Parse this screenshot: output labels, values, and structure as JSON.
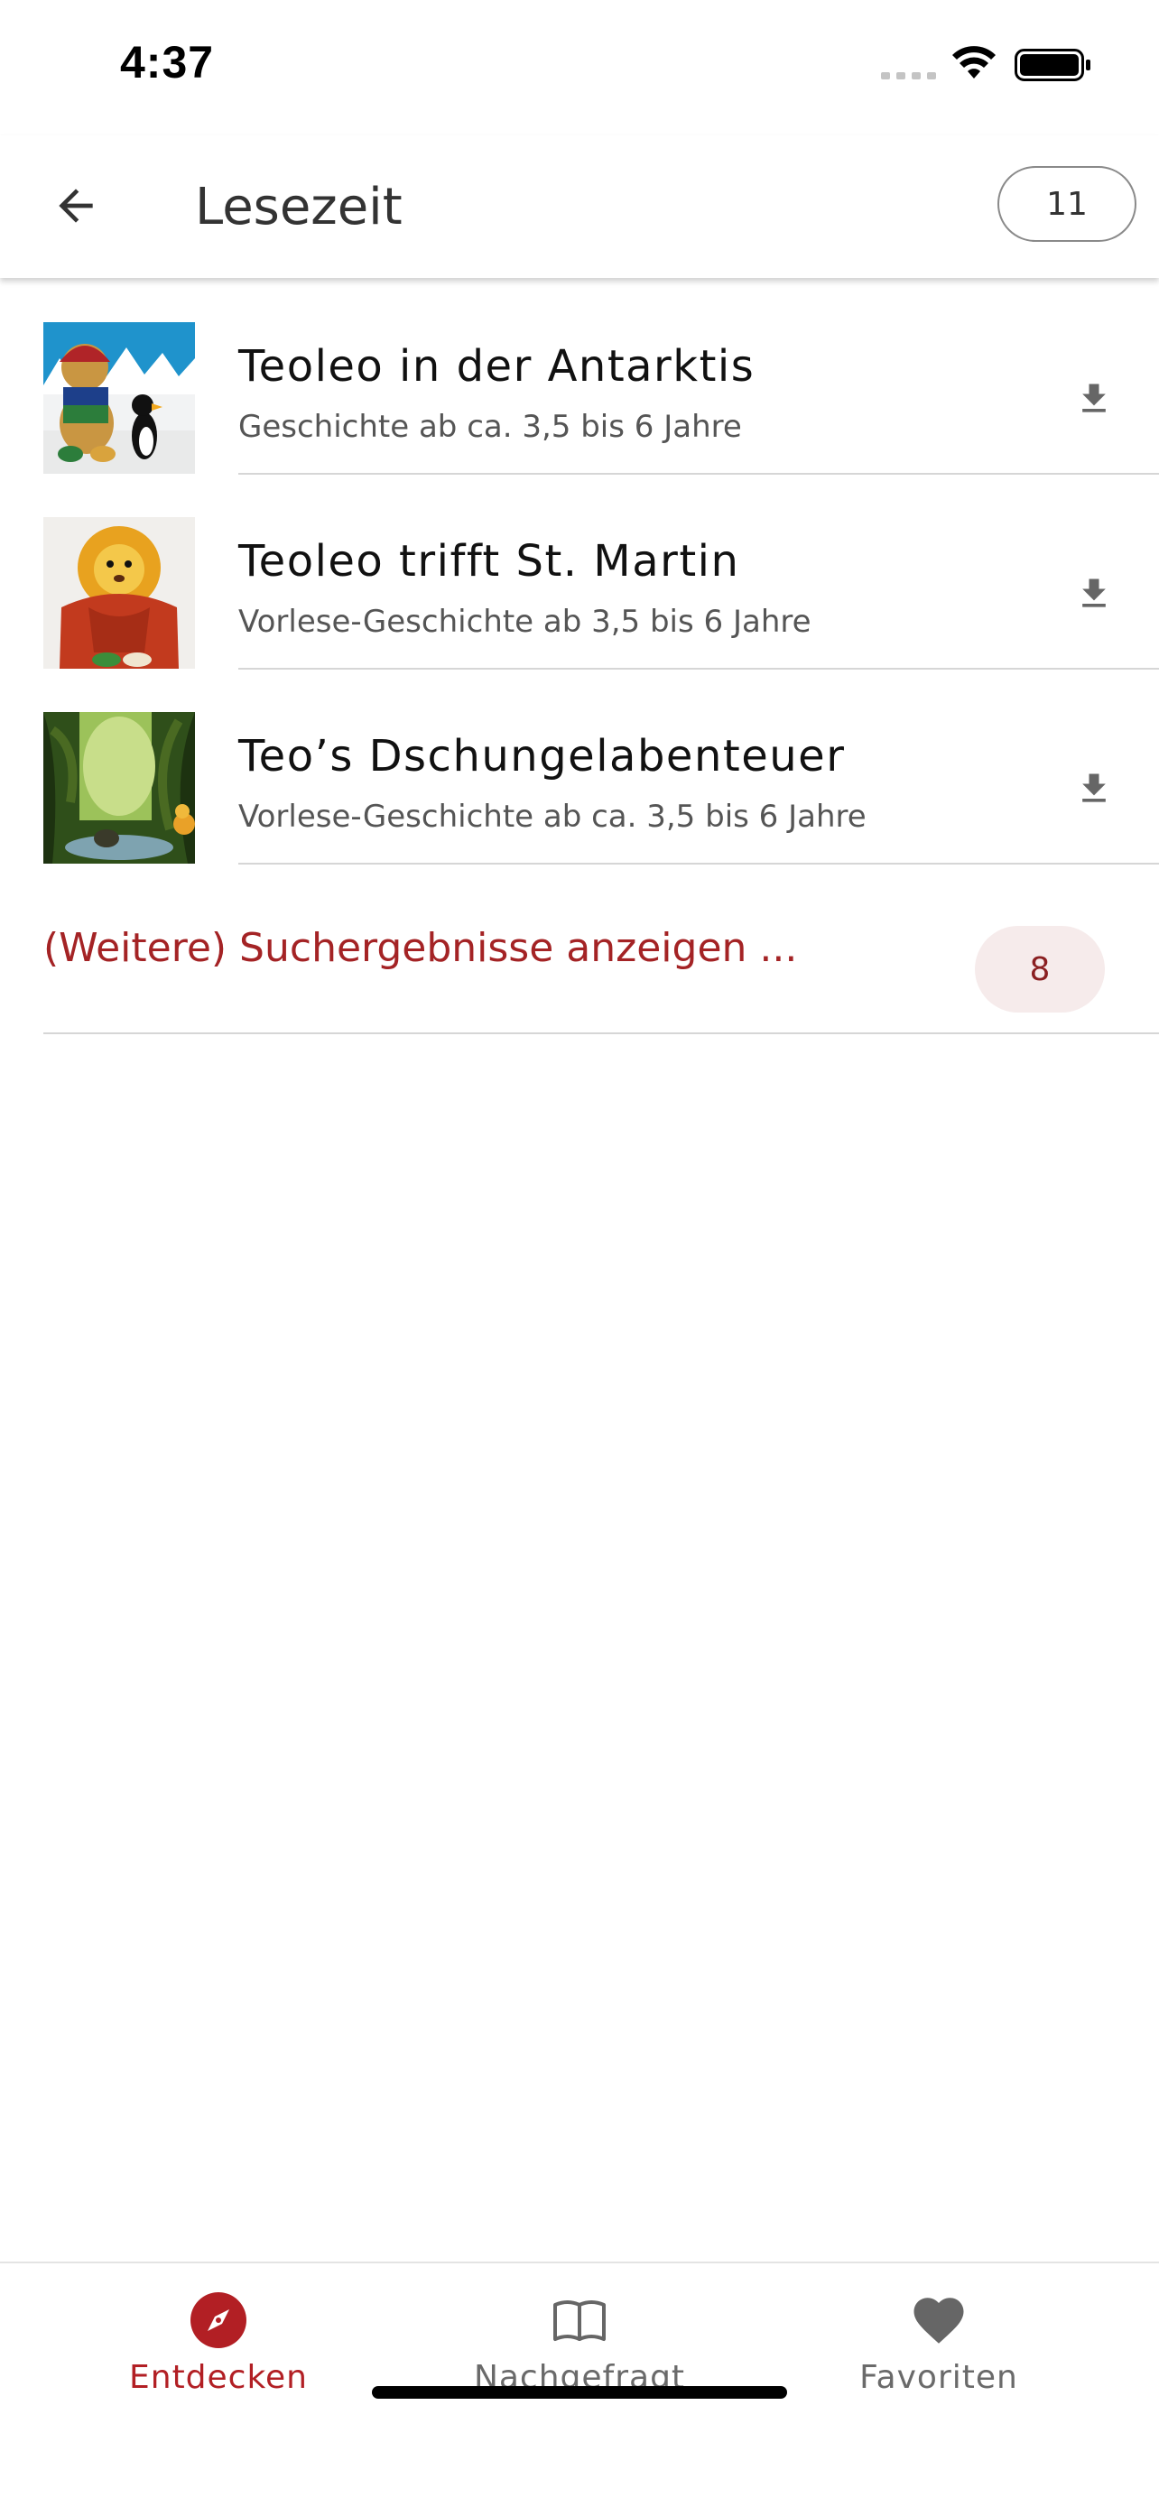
{
  "status_bar": {
    "time": "4:37"
  },
  "app_bar": {
    "title": "Lesezeit",
    "count": "11"
  },
  "results": [
    {
      "title": "Teoleo in der Antarktis",
      "subtitle": "Geschichte ab ca. 3,5 bis 6 Jahre",
      "thumbnail": "teddy-bear-with-penguin"
    },
    {
      "title": "Teoleo trifft St. Martin",
      "subtitle": "Vorlese-Geschichte ab 3,5 bis 6 Jahre",
      "thumbnail": "lion-with-red-cape"
    },
    {
      "title": "Teo’s Dschungelabenteuer",
      "subtitle": "Vorlese-Geschichte ab ca. 3,5 bis 6 Jahre",
      "thumbnail": "jungle-scene"
    }
  ],
  "more_results": {
    "label": "(Weitere) Suchergebnisse anzeigen ...",
    "count": "8"
  },
  "bottom_nav": {
    "items": [
      {
        "label": "Entdecken",
        "icon": "compass-icon",
        "active": true
      },
      {
        "label": "Nachgefragt",
        "icon": "book-icon",
        "active": false
      },
      {
        "label": "Favoriten",
        "icon": "heart-icon",
        "active": false
      }
    ]
  },
  "colors": {
    "accent": "#b21f24",
    "badge_background": "#f6ebeb",
    "text_secondary": "#555555",
    "divider": "#d6d6d6"
  }
}
